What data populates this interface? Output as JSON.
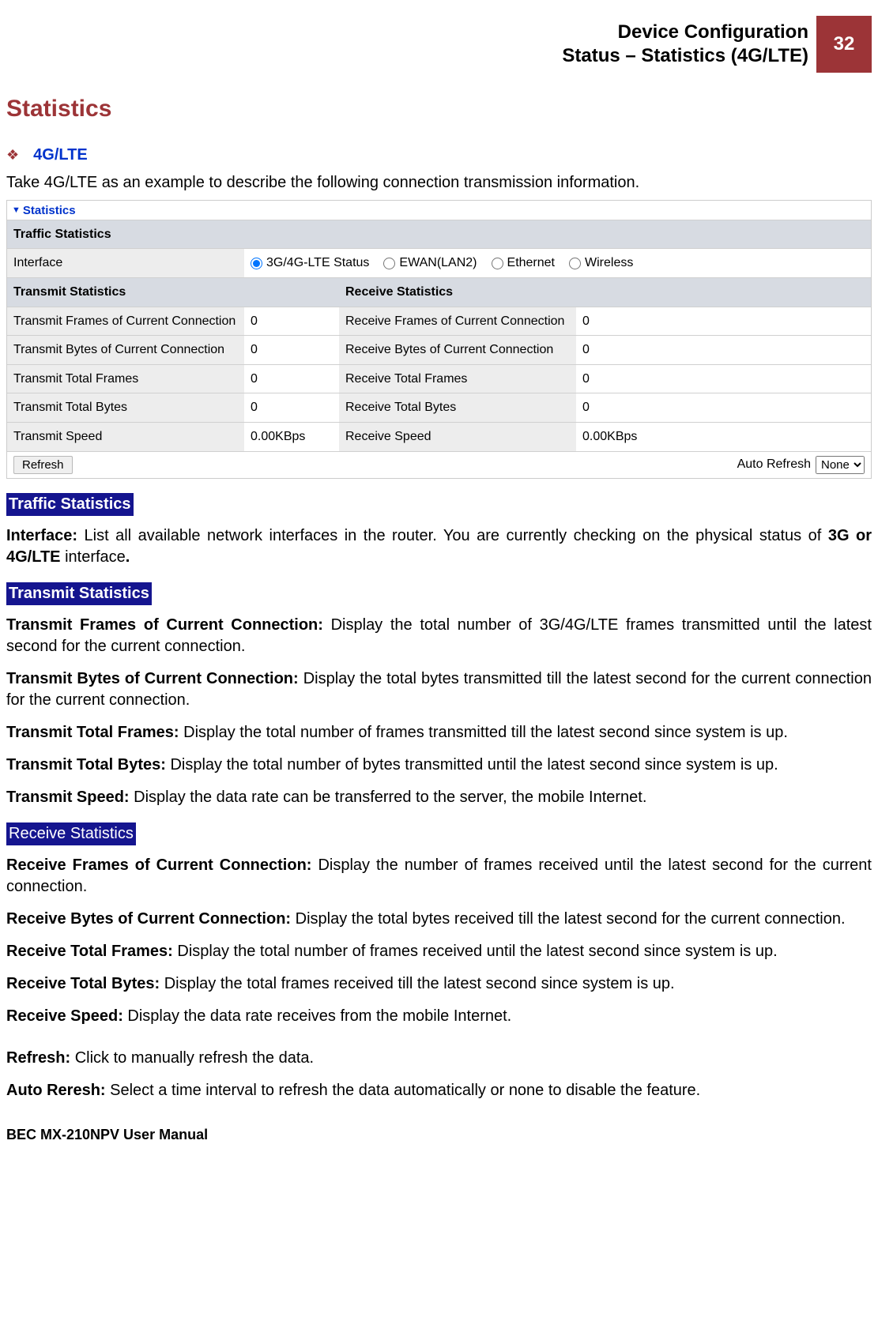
{
  "header": {
    "line1": "Device Configuration",
    "line2": "Status – Statistics (4G/LTE)",
    "page_number": "32"
  },
  "titles": {
    "statistics": "Statistics",
    "sub_4glte": "4G/LTE",
    "intro": "Take 4G/LTE as an example to describe the following connection transmission information."
  },
  "panel": {
    "heading": "Statistics",
    "traffic_statistics_label": "Traffic Statistics",
    "interface_label": "Interface",
    "interface_options": {
      "opt1": "3G/4G-LTE Status",
      "opt2": "EWAN(LAN2)",
      "opt3": "Ethernet",
      "opt4": "Wireless"
    },
    "transmit_header": "Transmit Statistics",
    "receive_header": "Receive Statistics",
    "rows": {
      "t1_lbl": "Transmit Frames of Current Connection",
      "t1_val": "0",
      "r1_lbl": "Receive Frames of Current Connection",
      "r1_val": "0",
      "t2_lbl": "Transmit Bytes of Current Connection",
      "t2_val": "0",
      "r2_lbl": "Receive Bytes of Current Connection",
      "r2_val": "0",
      "t3_lbl": "Transmit Total Frames",
      "t3_val": "0",
      "r3_lbl": "Receive Total Frames",
      "r3_val": "0",
      "t4_lbl": "Transmit Total Bytes",
      "t4_val": "0",
      "r4_lbl": "Receive Total Bytes",
      "r4_val": "0",
      "t5_lbl": "Transmit Speed",
      "t5_val": "0.00KBps",
      "r5_lbl": "Receive Speed",
      "r5_val": "0.00KBps"
    },
    "refresh_btn": "Refresh",
    "auto_refresh_label": "Auto Refresh",
    "auto_refresh_value": "None"
  },
  "descriptions": {
    "traffic_statistics_hl": "Traffic Statistics",
    "interface_b": "Interface: ",
    "interface_t1": "List all available network interfaces in the router.  You are currently checking on the physical status of ",
    "interface_b2": "3G or 4G/LTE",
    "interface_t2": " interface",
    "interface_dot": ".",
    "transmit_hl": "Transmit Statistics",
    "tfcc_b": "Transmit Frames of Current Connection: ",
    "tfcc_t": "Display the total number of 3G/4G/LTE frames transmitted until the latest second for the current connection.",
    "tbcc_b": "Transmit Bytes of Current Connection: ",
    "tbcc_t": "Display the total bytes transmitted till the latest second for the current connection for the current connection.",
    "ttf_b": "Transmit Total Frames: ",
    "ttf_t": "Display the total number of frames transmitted till the latest second since system is up.",
    "ttb_b": "Transmit Total Bytes: ",
    "ttb_t": "Display the total number of bytes transmitted until the latest second since system is up.",
    "ts_b": "Transmit Speed: ",
    "ts_t": "Display the data rate can be transferred to the server, the mobile Internet.",
    "receive_hl": "Receive Statistics",
    "rfcc_b": "Receive Frames of Current Connection: ",
    "rfcc_t": "Display the number of frames received until the latest second for the current connection.",
    "rbcc_b": "Receive Bytes of Current Connection: ",
    "rbcc_t": "Display the total bytes received till the latest second for the current connection.",
    "rtf_b": "Receive Total Frames: ",
    "rtf_t": "Display the total number of frames received until the latest second since system is up.",
    "rtb_b": "Receive Total Bytes: ",
    "rtb_t": "Display the total frames received till the latest second since system is up.",
    "rs_b": "Receive Speed: ",
    "rs_t": "Display the data rate receives from the mobile Internet.",
    "refresh_b": "Refresh: ",
    "refresh_t": "Click to manually refresh the data.",
    "autor_b": "Auto Reresh:  ",
    "autor_t": "Select a time interval to refresh the data automatically or none to disable the feature."
  },
  "footer": "BEC MX-210NPV User Manual"
}
